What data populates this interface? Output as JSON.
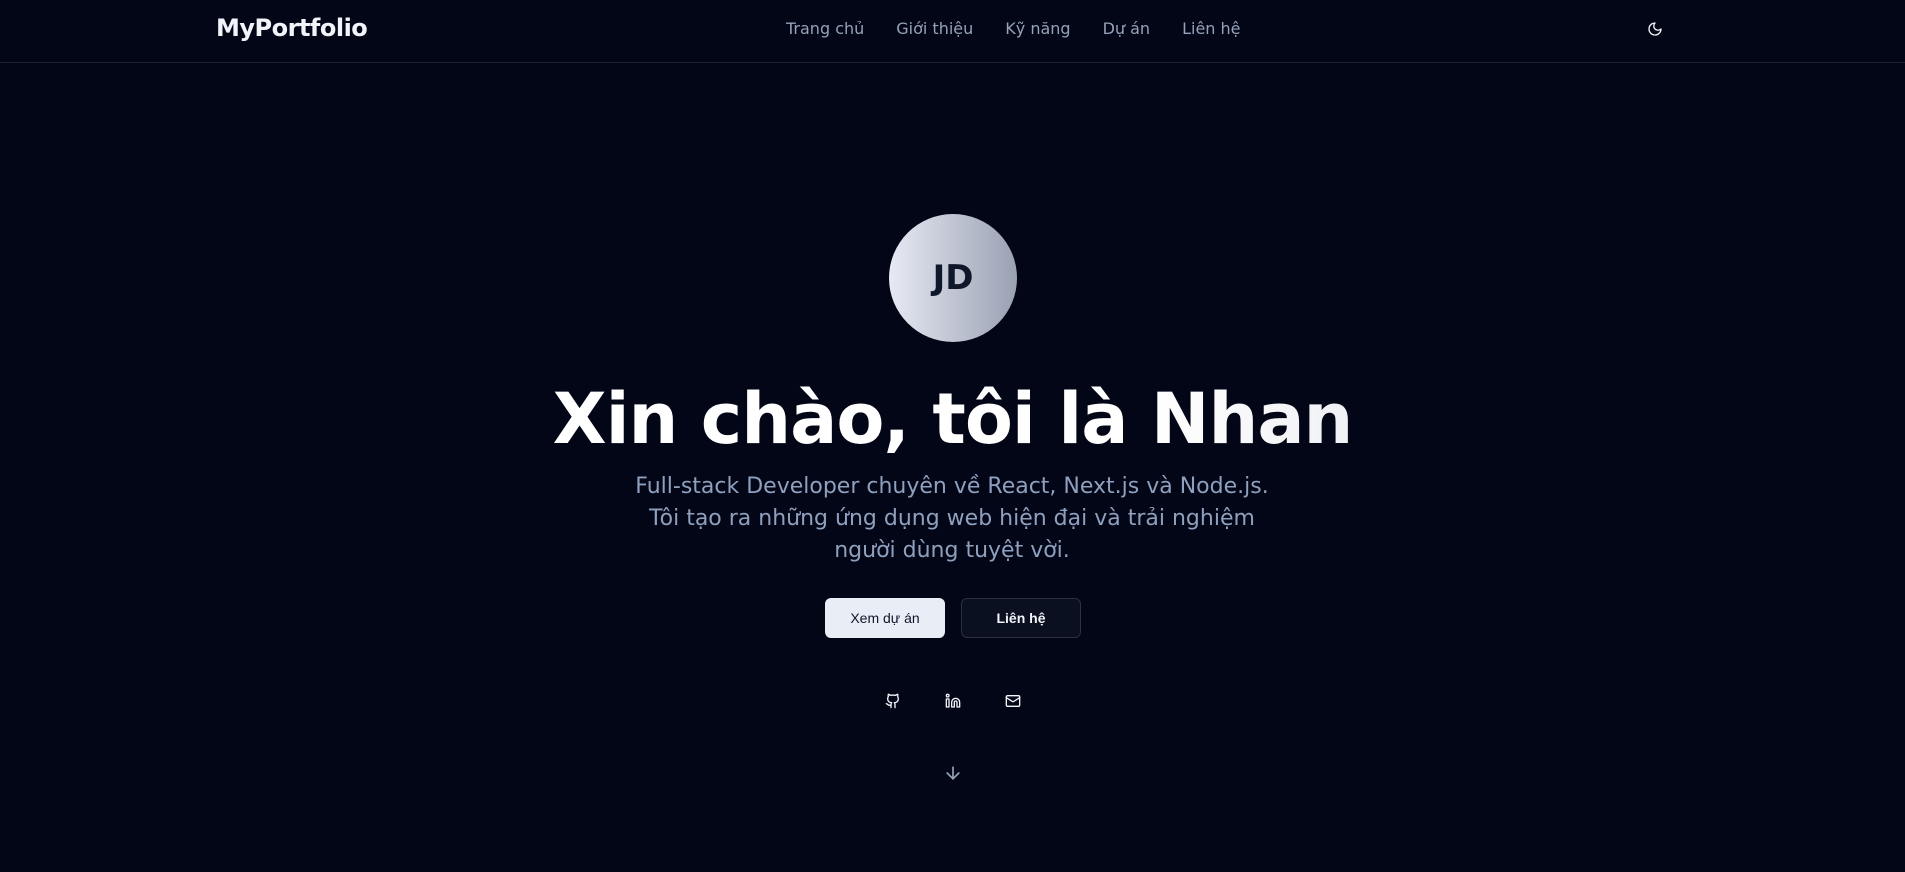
{
  "navbar": {
    "brand": "MyPortfolio",
    "links": [
      {
        "label": "Trang chủ"
      },
      {
        "label": "Giới thiệu"
      },
      {
        "label": "Kỹ năng"
      },
      {
        "label": "Dự án"
      },
      {
        "label": "Liên hệ"
      }
    ],
    "theme_toggle_icon": "moon-icon"
  },
  "hero": {
    "avatar_initials": "JD",
    "headline": "Xin chào, tôi là Nhan",
    "subtitle": "Full-stack Developer chuyên về React, Next.js và Node.js. Tôi tạo ra những ứng dụng web hiện đại và trải nghiệm người dùng tuyệt vời.",
    "primary_button": "Xem dự án",
    "secondary_button": "Liên hệ",
    "social_icons": [
      "github-icon",
      "linkedin-icon",
      "mail-icon"
    ],
    "scroll_icon": "arrow-down-icon"
  },
  "colors": {
    "background": "#030617",
    "text_muted": "#94a3b8",
    "subtitle": "#8ea0bd",
    "primary_button_bg": "#e9edf6"
  }
}
